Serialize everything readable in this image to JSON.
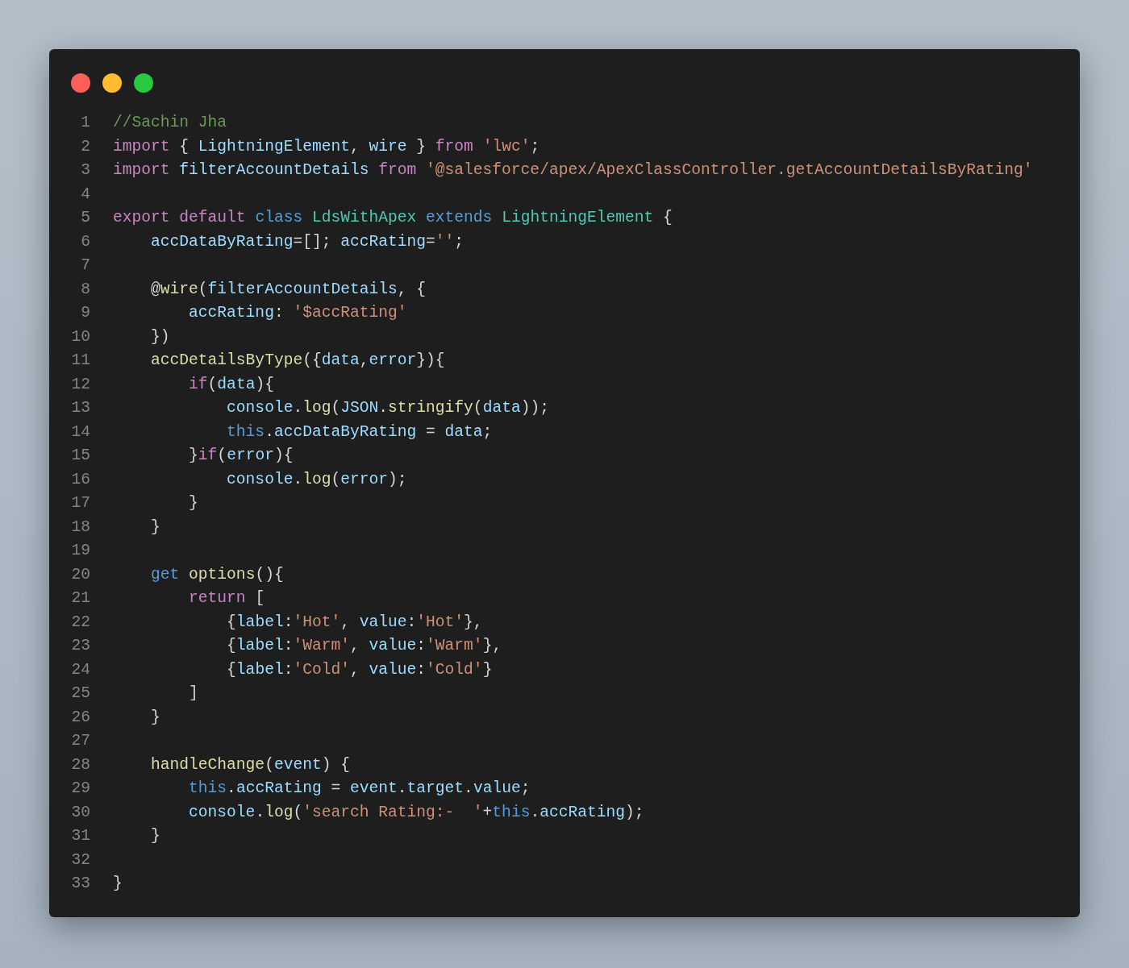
{
  "window": {
    "controls": [
      {
        "kind": "close"
      },
      {
        "kind": "minimize"
      },
      {
        "kind": "maximize"
      }
    ]
  },
  "code": {
    "lines": [
      {
        "number": "1",
        "tokens": [
          {
            "kind": "comment",
            "text": "//Sachin Jha"
          }
        ]
      },
      {
        "number": "2",
        "tokens": [
          {
            "kind": "keyword",
            "text": "import"
          },
          {
            "kind": "punct",
            "text": " { "
          },
          {
            "kind": "variable",
            "text": "LightningElement"
          },
          {
            "kind": "punct",
            "text": ", "
          },
          {
            "kind": "variable",
            "text": "wire"
          },
          {
            "kind": "punct",
            "text": " } "
          },
          {
            "kind": "keyword",
            "text": "from "
          },
          {
            "kind": "string",
            "text": "'lwc'"
          },
          {
            "kind": "punct",
            "text": ";"
          }
        ]
      },
      {
        "number": "3",
        "tokens": [
          {
            "kind": "keyword",
            "text": "import "
          },
          {
            "kind": "variable",
            "text": "filterAccountDetails "
          },
          {
            "kind": "keyword",
            "text": "from "
          },
          {
            "kind": "string",
            "text": "'@salesforce/apex/ApexClassController.getAccountDetailsByRating'"
          }
        ]
      },
      {
        "number": "4"
      },
      {
        "number": "5",
        "tokens": [
          {
            "kind": "keyword",
            "text": "export "
          },
          {
            "kind": "keyword",
            "text": "default "
          },
          {
            "kind": "storage",
            "text": "class "
          },
          {
            "kind": "type",
            "text": "LdsWithApex "
          },
          {
            "kind": "storage",
            "text": "extends "
          },
          {
            "kind": "type",
            "text": "LightningElement"
          },
          {
            "kind": "punct",
            "text": " {"
          }
        ]
      },
      {
        "number": "6",
        "tokens": [
          {
            "kind": "variable",
            "text": "    accDataByRating"
          },
          {
            "kind": "punct",
            "text": "=[]; "
          },
          {
            "kind": "variable",
            "text": "accRating"
          },
          {
            "kind": "punct",
            "text": "="
          },
          {
            "kind": "string",
            "text": "''"
          },
          {
            "kind": "punct",
            "text": ";"
          }
        ]
      },
      {
        "number": "7"
      },
      {
        "number": "8",
        "tokens": [
          {
            "kind": "punct",
            "text": "    @"
          },
          {
            "kind": "function",
            "text": "wire"
          },
          {
            "kind": "punct",
            "text": "("
          },
          {
            "kind": "variable",
            "text": "filterAccountDetails"
          },
          {
            "kind": "punct",
            "text": ", {"
          }
        ]
      },
      {
        "number": "9",
        "tokens": [
          {
            "kind": "variable",
            "text": "        accRating"
          },
          {
            "kind": "punct",
            "text": ": "
          },
          {
            "kind": "string",
            "text": "'$accRating'"
          }
        ]
      },
      {
        "number": "10",
        "tokens": [
          {
            "kind": "punct",
            "text": "    })"
          }
        ]
      },
      {
        "number": "11",
        "tokens": [
          {
            "kind": "function",
            "text": "    accDetailsByType"
          },
          {
            "kind": "punct",
            "text": "({"
          },
          {
            "kind": "variable",
            "text": "data"
          },
          {
            "kind": "punct",
            "text": ","
          },
          {
            "kind": "variable",
            "text": "error"
          },
          {
            "kind": "punct",
            "text": "}){"
          }
        ]
      },
      {
        "number": "12",
        "tokens": [
          {
            "kind": "keyword",
            "text": "        if"
          },
          {
            "kind": "punct",
            "text": "("
          },
          {
            "kind": "variable",
            "text": "data"
          },
          {
            "kind": "punct",
            "text": "){"
          }
        ]
      },
      {
        "number": "13",
        "tokens": [
          {
            "kind": "variable",
            "text": "            console"
          },
          {
            "kind": "punct",
            "text": "."
          },
          {
            "kind": "function",
            "text": "log"
          },
          {
            "kind": "punct",
            "text": "("
          },
          {
            "kind": "variable",
            "text": "JSON"
          },
          {
            "kind": "punct",
            "text": "."
          },
          {
            "kind": "function",
            "text": "stringify"
          },
          {
            "kind": "punct",
            "text": "("
          },
          {
            "kind": "variable",
            "text": "data"
          },
          {
            "kind": "punct",
            "text": "));"
          }
        ]
      },
      {
        "number": "14",
        "tokens": [
          {
            "kind": "storage",
            "text": "            this"
          },
          {
            "kind": "punct",
            "text": "."
          },
          {
            "kind": "variable",
            "text": "accDataByRating"
          },
          {
            "kind": "punct",
            "text": " = "
          },
          {
            "kind": "variable",
            "text": "data"
          },
          {
            "kind": "punct",
            "text": ";"
          }
        ]
      },
      {
        "number": "15",
        "tokens": [
          {
            "kind": "punct",
            "text": "        }"
          },
          {
            "kind": "keyword",
            "text": "if"
          },
          {
            "kind": "punct",
            "text": "("
          },
          {
            "kind": "variable",
            "text": "error"
          },
          {
            "kind": "punct",
            "text": "){"
          }
        ]
      },
      {
        "number": "16",
        "tokens": [
          {
            "kind": "variable",
            "text": "            console"
          },
          {
            "kind": "punct",
            "text": "."
          },
          {
            "kind": "function",
            "text": "log"
          },
          {
            "kind": "punct",
            "text": "("
          },
          {
            "kind": "variable",
            "text": "error"
          },
          {
            "kind": "punct",
            "text": ");"
          }
        ]
      },
      {
        "number": "17",
        "tokens": [
          {
            "kind": "punct",
            "text": "        }"
          }
        ]
      },
      {
        "number": "18",
        "tokens": [
          {
            "kind": "punct",
            "text": "    }"
          }
        ]
      },
      {
        "number": "19"
      },
      {
        "number": "20",
        "tokens": [
          {
            "kind": "storage",
            "text": "    get "
          },
          {
            "kind": "function",
            "text": "options"
          },
          {
            "kind": "punct",
            "text": "(){"
          }
        ]
      },
      {
        "number": "21",
        "tokens": [
          {
            "kind": "keyword",
            "text": "        return"
          },
          {
            "kind": "punct",
            "text": " ["
          }
        ]
      },
      {
        "number": "22",
        "tokens": [
          {
            "kind": "punct",
            "text": "            {"
          },
          {
            "kind": "variable",
            "text": "label"
          },
          {
            "kind": "punct",
            "text": ":"
          },
          {
            "kind": "string",
            "text": "'Hot'"
          },
          {
            "kind": "punct",
            "text": ", "
          },
          {
            "kind": "variable",
            "text": "value"
          },
          {
            "kind": "punct",
            "text": ":"
          },
          {
            "kind": "string",
            "text": "'Hot'"
          },
          {
            "kind": "punct",
            "text": "},"
          }
        ]
      },
      {
        "number": "23",
        "tokens": [
          {
            "kind": "punct",
            "text": "            {"
          },
          {
            "kind": "variable",
            "text": "label"
          },
          {
            "kind": "punct",
            "text": ":"
          },
          {
            "kind": "string",
            "text": "'Warm'"
          },
          {
            "kind": "punct",
            "text": ", "
          },
          {
            "kind": "variable",
            "text": "value"
          },
          {
            "kind": "punct",
            "text": ":"
          },
          {
            "kind": "string",
            "text": "'Warm'"
          },
          {
            "kind": "punct",
            "text": "},"
          }
        ]
      },
      {
        "number": "24",
        "tokens": [
          {
            "kind": "punct",
            "text": "            {"
          },
          {
            "kind": "variable",
            "text": "label"
          },
          {
            "kind": "punct",
            "text": ":"
          },
          {
            "kind": "string",
            "text": "'Cold'"
          },
          {
            "kind": "punct",
            "text": ", "
          },
          {
            "kind": "variable",
            "text": "value"
          },
          {
            "kind": "punct",
            "text": ":"
          },
          {
            "kind": "string",
            "text": "'Cold'"
          },
          {
            "kind": "punct",
            "text": "}"
          }
        ]
      },
      {
        "number": "25",
        "tokens": [
          {
            "kind": "punct",
            "text": "        ]"
          }
        ]
      },
      {
        "number": "26",
        "tokens": [
          {
            "kind": "punct",
            "text": "    }"
          }
        ]
      },
      {
        "number": "27"
      },
      {
        "number": "28",
        "tokens": [
          {
            "kind": "function",
            "text": "    handleChange"
          },
          {
            "kind": "punct",
            "text": "("
          },
          {
            "kind": "variable",
            "text": "event"
          },
          {
            "kind": "punct",
            "text": ") {"
          }
        ]
      },
      {
        "number": "29",
        "tokens": [
          {
            "kind": "storage",
            "text": "        this"
          },
          {
            "kind": "punct",
            "text": "."
          },
          {
            "kind": "variable",
            "text": "accRating"
          },
          {
            "kind": "punct",
            "text": " = "
          },
          {
            "kind": "variable",
            "text": "event"
          },
          {
            "kind": "punct",
            "text": "."
          },
          {
            "kind": "variable",
            "text": "target"
          },
          {
            "kind": "punct",
            "text": "."
          },
          {
            "kind": "variable",
            "text": "value"
          },
          {
            "kind": "punct",
            "text": ";"
          }
        ]
      },
      {
        "number": "30",
        "tokens": [
          {
            "kind": "variable",
            "text": "        console"
          },
          {
            "kind": "punct",
            "text": "."
          },
          {
            "kind": "function",
            "text": "log"
          },
          {
            "kind": "punct",
            "text": "("
          },
          {
            "kind": "string",
            "text": "'search Rating:-  '"
          },
          {
            "kind": "punct",
            "text": "+"
          },
          {
            "kind": "storage",
            "text": "this"
          },
          {
            "kind": "punct",
            "text": "."
          },
          {
            "kind": "variable",
            "text": "accRating"
          },
          {
            "kind": "punct",
            "text": ");"
          }
        ]
      },
      {
        "number": "31",
        "tokens": [
          {
            "kind": "punct",
            "text": "    }"
          }
        ]
      },
      {
        "number": "32"
      },
      {
        "number": "33",
        "tokens": [
          {
            "kind": "punct",
            "text": "}"
          }
        ]
      }
    ]
  }
}
